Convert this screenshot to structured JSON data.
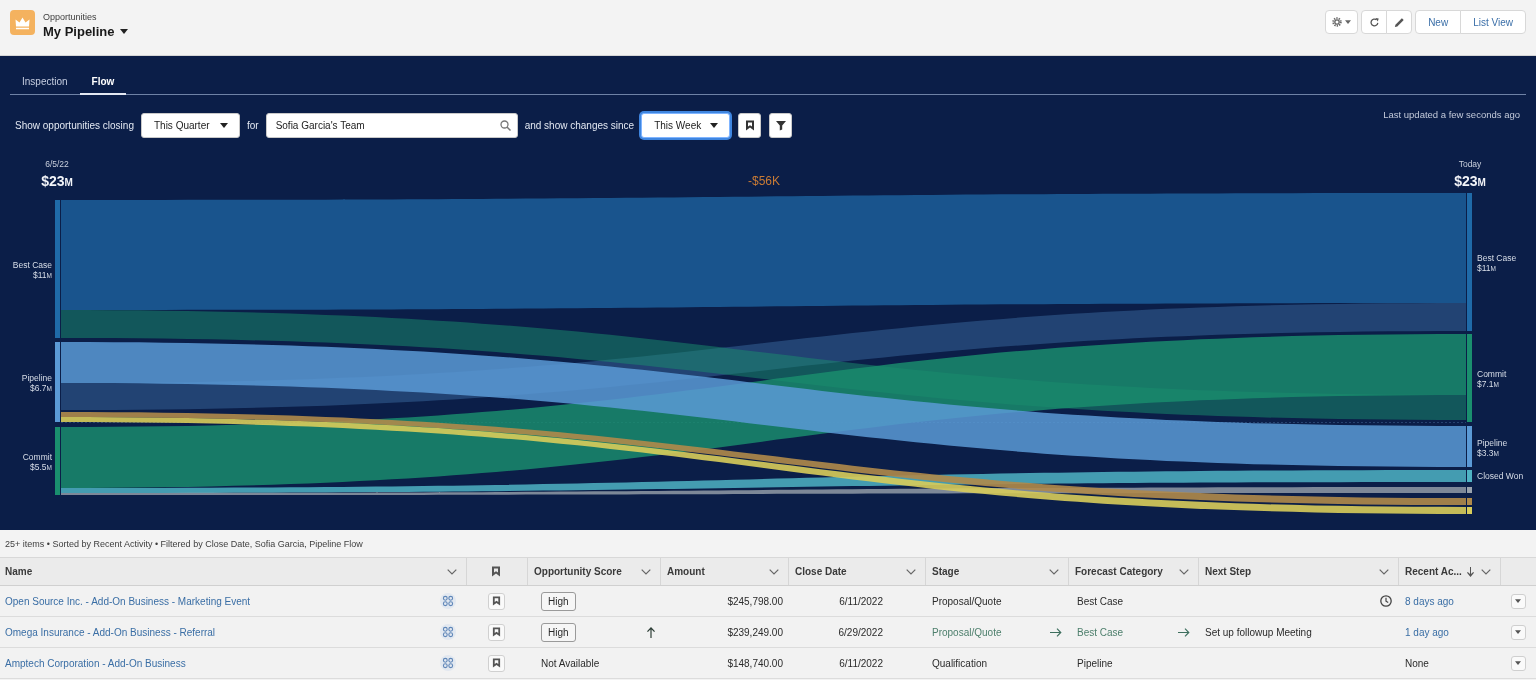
{
  "header": {
    "object": "Opportunities",
    "title": "My Pipeline",
    "actions": [
      {
        "kind": "settings"
      },
      {
        "kind": "refresh"
      },
      {
        "kind": "edit"
      },
      {
        "kind": "text",
        "label": "New"
      },
      {
        "kind": "text",
        "label": "List View"
      }
    ]
  },
  "tabs": [
    {
      "label": "Inspection",
      "selected": false
    },
    {
      "label": "Flow",
      "selected": true
    }
  ],
  "filters": {
    "lead": "Show opportunities closing",
    "period": {
      "value": "This Quarter",
      "focused": false
    },
    "for_label": "for",
    "team": {
      "value": "Sofia Garcia's Team"
    },
    "since_label": "and show changes since",
    "since": {
      "value": "This Week",
      "focused": true
    },
    "tools": [
      {
        "kind": "bookmark"
      },
      {
        "kind": "filter"
      }
    ],
    "updated": "Last updated a few seconds ago"
  },
  "flow_chart": {
    "start": {
      "date": "6/5/22",
      "total": "$23",
      "unit": "M"
    },
    "change": "-$56K",
    "end": {
      "date": "Today",
      "total": "$23",
      "unit": "M"
    },
    "start_nodes": [
      {
        "label": "Best Case",
        "amount": "$11",
        "unit": "M",
        "color": "#1f6aa8"
      },
      {
        "label": "Pipeline",
        "amount": "$6.7",
        "unit": "M",
        "color": "#5b9ad6"
      },
      {
        "label": "Commit",
        "amount": "$5.5",
        "unit": "M",
        "color": "#1a8f6e"
      }
    ],
    "end_nodes": [
      {
        "label": "Best Case",
        "amount": "$11",
        "unit": "M",
        "color": "#1f6aa8"
      },
      {
        "label": "Commit",
        "amount": "$7.1",
        "unit": "M",
        "color": "#1a8f6e"
      },
      {
        "label": "Pipeline",
        "amount": "$3.3",
        "unit": "M",
        "color": "#5b9ad6"
      },
      {
        "label": "Closed Won",
        "color": "#4fb3c4"
      },
      {
        "color": "#9aa3ad"
      },
      {
        "color": "#b08a4a"
      },
      {
        "color": "#d8cc5a"
      }
    ]
  },
  "list": {
    "summary": "25+ items • Sorted by Recent Activity • Filtered by Close Date, Sofia Garcia, Pipeline Flow",
    "columns": [
      {
        "kind": "text",
        "label": "Name",
        "sorted": false
      },
      {
        "kind": "bookmark"
      },
      {
        "kind": "text",
        "label": "Opportunity Score",
        "sorted": false
      },
      {
        "kind": "text",
        "label": "Amount",
        "sorted": false
      },
      {
        "kind": "text",
        "label": "Close Date",
        "sorted": false
      },
      {
        "kind": "text",
        "label": "Stage",
        "sorted": false
      },
      {
        "kind": "text",
        "label": "Forecast Category",
        "sorted": false
      },
      {
        "kind": "text",
        "label": "Next Step",
        "sorted": false
      },
      {
        "kind": "text",
        "label": "Recent Ac...",
        "sorted": true
      }
    ],
    "rows": [
      {
        "name": "Open Source Inc. - Add-On Business - Marketing Event",
        "score": {
          "text": "High",
          "kind": "badge"
        },
        "score_rising": false,
        "amount": "$245,798.00",
        "close_date": "6/11/2022",
        "stage": {
          "text": "Proposal/Quote",
          "changed": false
        },
        "forecast": {
          "text": "Best Case",
          "changed": false
        },
        "reminder": true,
        "recent": {
          "text": "8 days ago",
          "kind": "link"
        }
      },
      {
        "name": "Omega Insurance - Add-On Business - Referral",
        "score": {
          "text": "High",
          "kind": "badge"
        },
        "score_rising": true,
        "amount": "$239,249.00",
        "close_date": "6/29/2022",
        "stage": {
          "text": "Proposal/Quote",
          "changed": true
        },
        "forecast": {
          "text": "Best Case",
          "changed": true
        },
        "next_step": "Set up followup Meeting",
        "reminder": false,
        "recent": {
          "text": "1 day ago",
          "kind": "link"
        }
      },
      {
        "name": "Amptech Corporation - Add-On Business",
        "score": {
          "text": "Not Available",
          "kind": "plain"
        },
        "score_rising": false,
        "amount": "$148,740.00",
        "close_date": "6/11/2022",
        "stage": {
          "text": "Qualification",
          "changed": false
        },
        "forecast": {
          "text": "Pipeline",
          "changed": false
        },
        "reminder": false,
        "recent": {
          "text": "None",
          "kind": "plain"
        }
      }
    ]
  }
}
